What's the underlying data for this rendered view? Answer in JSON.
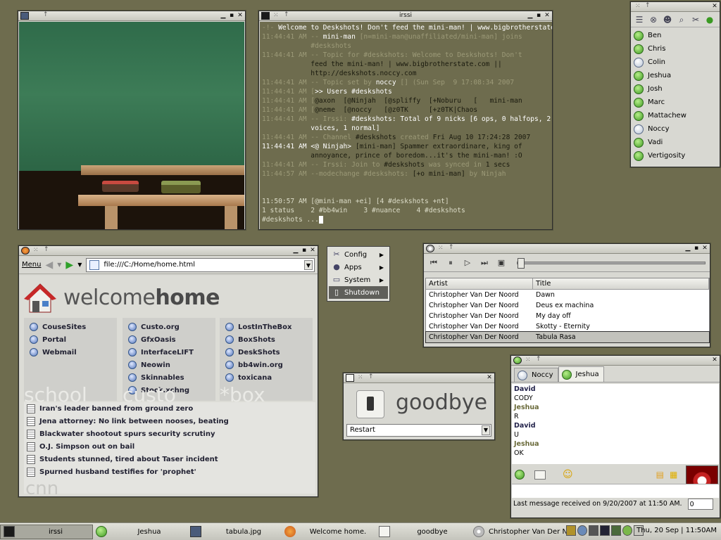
{
  "image_window": {
    "title": ""
  },
  "irssi": {
    "title": "irssi",
    "lines": [
      {
        "parts": [
          {
            "t": "-!- ",
            "c": "dim"
          },
          {
            "t": "Welcome to Deskshots! Don't feed the mini-man! | www.bigbrotherstate",
            "c": "hl"
          }
        ]
      },
      {
        "parts": [
          {
            "t": "11:44:41 AM -- ",
            "c": "dim"
          },
          {
            "t": "mini-man",
            "c": "hl"
          },
          {
            "t": " [n=mini-man@unaffiliated/mini-man] joins",
            "c": "dim"
          }
        ]
      },
      {
        "parts": [
          {
            "t": "            #deskshots",
            "c": "dim"
          }
        ]
      },
      {
        "parts": [
          {
            "t": "11:44:41 AM -- Topic for ",
            "c": "dim"
          },
          {
            "t": "#deskshots: Welcome to Deskshots! Don't",
            "c": "dim"
          }
        ]
      },
      {
        "parts": [
          {
            "t": "            feed the mini-man! | www.bigbrotherstate.com ||",
            "c": ""
          }
        ]
      },
      {
        "parts": [
          {
            "t": "            http://deskshots.noccy.com",
            "c": ""
          }
        ]
      },
      {
        "parts": [
          {
            "t": "11:44:41 AM -- Topic set by ",
            "c": "dim"
          },
          {
            "t": "noccy",
            "c": "hl"
          },
          {
            "t": " [] (Sun Sep  9 17:08:34 2007",
            "c": "dim"
          }
        ]
      },
      {
        "parts": [
          {
            "t": "11:44:41 AM [",
            "c": "dim"
          },
          {
            "t": ">> Users #deskshots",
            "c": "hl"
          }
        ]
      },
      {
        "parts": [
          {
            "t": "11:44:41 AM [",
            "c": "dim"
          },
          {
            "t": "@axon  [@Ninjah  [@spliffy  [+Noburu   [   mini-man",
            "c": ""
          }
        ]
      },
      {
        "parts": [
          {
            "t": "11:44:41 AM [",
            "c": "dim"
          },
          {
            "t": "@neme  [@noccy   [@z0TK     [+z0TK|Chaos",
            "c": ""
          }
        ]
      },
      {
        "parts": [
          {
            "t": "11:44:41 AM -- Irssi: ",
            "c": "dim"
          },
          {
            "t": "#deskshots",
            "c": "hl"
          },
          {
            "t": ": Total of 9 nicks [6 ops, 0 halfops, 2",
            "c": "hl"
          }
        ]
      },
      {
        "parts": [
          {
            "t": "            voices, 1 normal]",
            "c": "hl"
          }
        ]
      },
      {
        "parts": [
          {
            "t": "11:44:41 AM -- Channel ",
            "c": "dim"
          },
          {
            "t": "#deskshots",
            "c": ""
          },
          {
            "t": " created ",
            "c": "dim"
          },
          {
            "t": "Fri Aug 10 17:24:28 2007",
            "c": ""
          }
        ]
      },
      {
        "parts": [
          {
            "t": "11:44:41 AM <@ Ninjah> ",
            "c": "hl"
          },
          {
            "t": "[mini-man] Spammer extraordinare, king of",
            "c": ""
          }
        ]
      },
      {
        "parts": [
          {
            "t": "            annoyance, prince of boredom...it's the mini-man! :O",
            "c": ""
          }
        ]
      },
      {
        "parts": [
          {
            "t": "11:44:41 AM -- Irssi: Join to ",
            "c": "dim"
          },
          {
            "t": "#deskshots",
            "c": ""
          },
          {
            "t": " was synced in ",
            "c": "dim"
          },
          {
            "t": "1 secs",
            "c": ""
          }
        ]
      },
      {
        "parts": [
          {
            "t": "11:44:57 AM --modechange #deskshots: ",
            "c": "dim"
          },
          {
            "t": "[+o mini-man]",
            "c": ""
          },
          {
            "t": " by Ninjah",
            "c": "dim"
          }
        ]
      }
    ],
    "status1": "11:50:57 AM [@mini-man +ei] [4 #deskshots +nt]",
    "status2": "1 status    2 #bb4win    3 #nuance    4 #deskshots",
    "prompt": "#deskshots ..."
  },
  "buddies": {
    "items": [
      {
        "name": "Ben",
        "status": "online"
      },
      {
        "name": "Chris",
        "status": "online"
      },
      {
        "name": "Colin",
        "status": "away"
      },
      {
        "name": "Jeshua",
        "status": "online"
      },
      {
        "name": "Josh",
        "status": "online"
      },
      {
        "name": "Marc",
        "status": "online"
      },
      {
        "name": "Mattachew",
        "status": "online"
      },
      {
        "name": "Noccy",
        "status": "away"
      },
      {
        "name": "Vadi",
        "status": "online"
      },
      {
        "name": "Vertigosity",
        "status": "online"
      }
    ]
  },
  "firefox": {
    "menu_label": "Menu",
    "url": "file:///C:/Home/home.html",
    "heading_light": "welcome",
    "heading_bold": "home",
    "columns": [
      {
        "big": "school",
        "links": [
          "CouseSites",
          "Portal",
          "Webmail"
        ]
      },
      {
        "big": "custo",
        "links": [
          "Custo.org",
          "GfxOasis",
          "InterfaceLIFT",
          "Neowin",
          "Skinnables",
          "Stock.xchng"
        ]
      },
      {
        "big": "*box",
        "links": [
          "LostInTheBox",
          "BoxShots",
          "DeskShots",
          "bb4win.org",
          "toxicana"
        ]
      }
    ],
    "news_big": "cnn",
    "news": [
      "Iran's leader banned from ground zero",
      "Jena attorney: No link between nooses, beating",
      "Blackwater shootout spurs security scrutiny",
      "O.J. Simpson out on bail",
      "Students stunned, tired about Taser incident",
      "Spurned husband testifies for 'prophet'"
    ]
  },
  "menu": {
    "items": [
      {
        "label": "Config",
        "icon": "tools-icon",
        "sub": true
      },
      {
        "label": "Apps",
        "icon": "apps-icon",
        "sub": true
      },
      {
        "label": "System",
        "icon": "monitor-icon",
        "sub": true
      },
      {
        "label": "Shutdown",
        "icon": "power-icon",
        "sub": false,
        "selected": true
      }
    ]
  },
  "player": {
    "col_artist": "Artist",
    "col_title": "Title",
    "rows": [
      {
        "artist": "Christopher Van Der Noord",
        "title": "Dawn"
      },
      {
        "artist": "Christopher Van Der Noord",
        "title": "Deus ex machina"
      },
      {
        "artist": "Christopher Van Der Noord",
        "title": "My day off"
      },
      {
        "artist": "Christopher Van Der Noord",
        "title": "Skotty - Eternity"
      },
      {
        "artist": "Christopher Van Der Noord",
        "title": "Tabula Rasa",
        "selected": true
      }
    ],
    "position": 0.0
  },
  "goodbye": {
    "title": "goodbye",
    "selected": "Restart"
  },
  "chat": {
    "tabs": [
      {
        "name": "Noccy",
        "status": "away"
      },
      {
        "name": "Jeshua",
        "status": "online",
        "active": true
      }
    ],
    "messages": [
      {
        "nick": "David",
        "color": "#22224a",
        "text": "CODY"
      },
      {
        "nick": "Jeshua",
        "color": "#6a6a3a",
        "text": "R"
      },
      {
        "nick": "David",
        "color": "#22224a",
        "text": "U"
      },
      {
        "nick": "Jeshua",
        "color": "#6a6a3a",
        "text": "OK"
      }
    ],
    "status": "Last message received on 9/20/2007 at 11:50 AM.",
    "count": "0"
  },
  "taskbar": {
    "tasks": [
      {
        "label": "irssi",
        "active": true
      },
      {
        "label": "Jeshua"
      },
      {
        "label": "tabula.jpg"
      },
      {
        "label": "Welcome home."
      },
      {
        "label": "goodbye"
      },
      {
        "label": "Christopher Van Der N..."
      }
    ],
    "clock": "Thu, 20 Sep | 11:50AM"
  }
}
